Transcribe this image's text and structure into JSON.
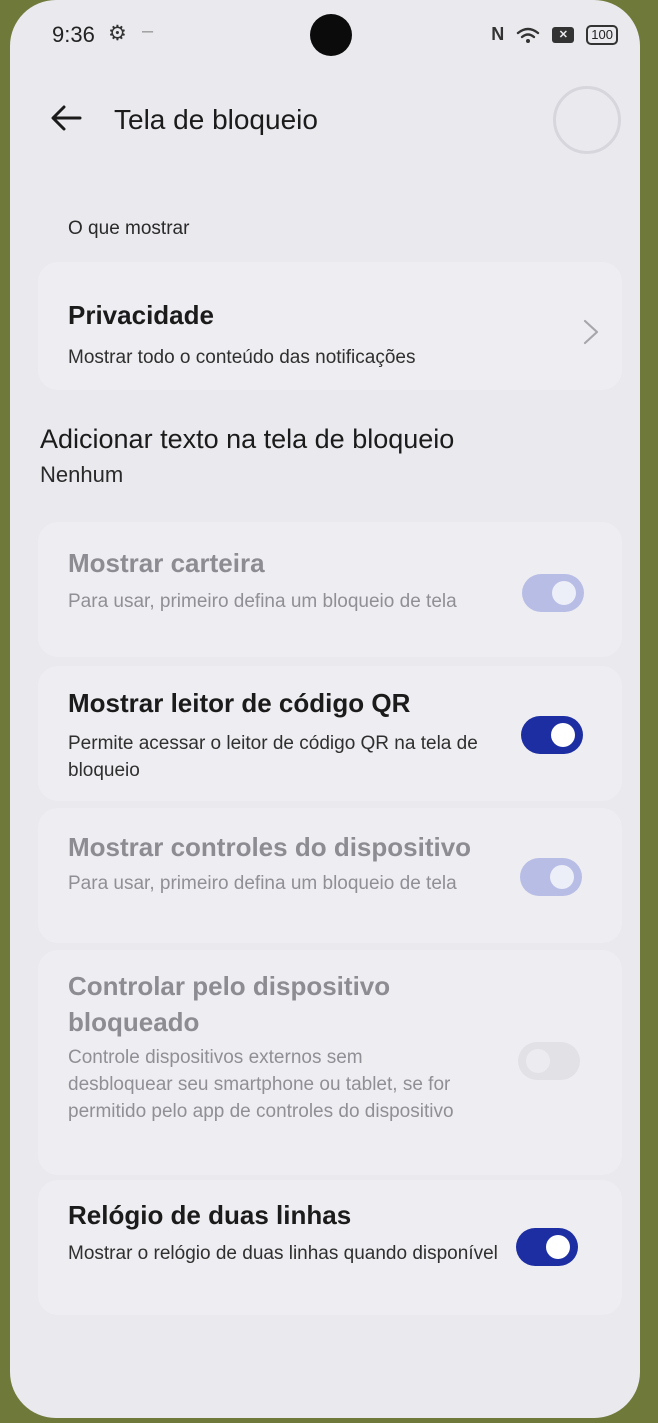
{
  "status_bar": {
    "time": "9:36",
    "gear_icon": "⚙",
    "dash": "–",
    "nfc_label": "N",
    "sim_label": "✕",
    "battery_level": "100"
  },
  "header": {
    "title": "Tela de bloqueio"
  },
  "section": {
    "title": "O que mostrar"
  },
  "items": {
    "privacy": {
      "title": "Privacidade",
      "subtitle": "Mostrar todo o conteúdo das notificações"
    },
    "lock_text": {
      "title": "Adicionar texto na tela de bloqueio",
      "subtitle": "Nenhum"
    },
    "wallet": {
      "title": "Mostrar carteira",
      "subtitle": "Para usar, primeiro defina um bloqueio de tela",
      "enabled": false,
      "checked": true
    },
    "qr": {
      "title": "Mostrar leitor de código QR",
      "subtitle": "Permite acessar o leitor de código QR na tela de bloqueio",
      "enabled": true,
      "checked": true
    },
    "device_controls": {
      "title": "Mostrar controles do dispositivo",
      "subtitle": "Para usar, primeiro defina um bloqueio de tela",
      "enabled": false,
      "checked": true
    },
    "locked_control": {
      "title": "Controlar pelo dispositivo bloqueado",
      "subtitle": "Controle dispositivos externos sem desbloquear seu smartphone ou tablet, se for permitido pelo app de controles do dispositivo",
      "enabled": false,
      "checked": false
    },
    "double_clock": {
      "title": "Relógio de duas linhas",
      "subtitle": "Mostrar o relógio de duas linhas quando disponível",
      "enabled": true,
      "checked": true
    }
  },
  "colors": {
    "accent": "#1d2ea3",
    "background": "#e9e9ee",
    "card": "#eeeef2"
  }
}
